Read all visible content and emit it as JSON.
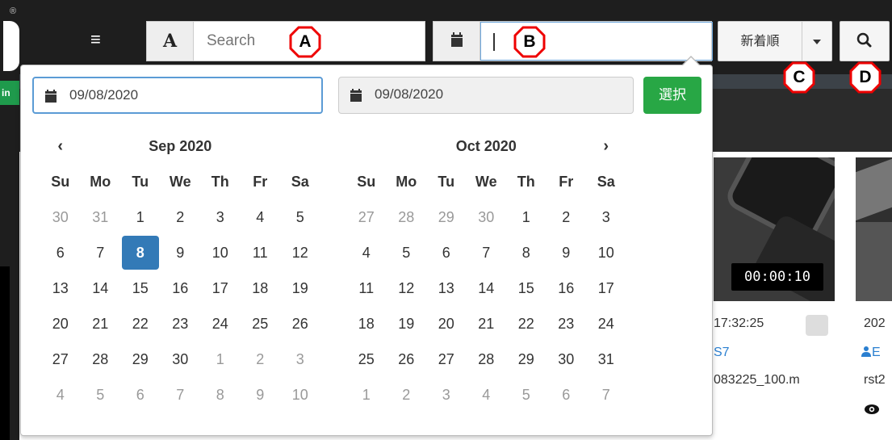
{
  "header": {
    "search_prefix": "A",
    "search_placeholder": "Search",
    "date_field_value": "",
    "sort_label": "新着順"
  },
  "annotations": {
    "a": "A",
    "b": "B",
    "c": "C",
    "d": "D"
  },
  "date_picker": {
    "start_date": "09/08/2020",
    "end_date": "09/08/2020",
    "select_label": "選択",
    "prev_label": "‹",
    "next_label": "›",
    "weekdays": [
      "Su",
      "Mo",
      "Tu",
      "We",
      "Th",
      "Fr",
      "Sa"
    ],
    "left": {
      "month": "Sep 2020",
      "weeks": [
        [
          "30",
          "31",
          "1",
          "2",
          "3",
          "4",
          "5"
        ],
        [
          "6",
          "7",
          "8",
          "9",
          "10",
          "11",
          "12"
        ],
        [
          "13",
          "14",
          "15",
          "16",
          "17",
          "18",
          "19"
        ],
        [
          "20",
          "21",
          "22",
          "23",
          "24",
          "25",
          "26"
        ],
        [
          "27",
          "28",
          "29",
          "30",
          "1",
          "2",
          "3"
        ],
        [
          "4",
          "5",
          "6",
          "7",
          "8",
          "9",
          "10"
        ]
      ],
      "selected": "8"
    },
    "right": {
      "month": "Oct 2020",
      "weeks": [
        [
          "27",
          "28",
          "29",
          "30",
          "1",
          "2",
          "3"
        ],
        [
          "4",
          "5",
          "6",
          "7",
          "8",
          "9",
          "10"
        ],
        [
          "11",
          "12",
          "13",
          "14",
          "15",
          "16",
          "17"
        ],
        [
          "18",
          "19",
          "20",
          "21",
          "22",
          "23",
          "24"
        ],
        [
          "25",
          "26",
          "27",
          "28",
          "29",
          "30",
          "31"
        ],
        [
          "1",
          "2",
          "3",
          "4",
          "5",
          "6",
          "7"
        ]
      ]
    }
  },
  "cards": [
    {
      "duration": "00:00:10",
      "time": "17:32:25",
      "user": "S7",
      "file": "083225_100.m"
    },
    {
      "time": "202",
      "user": "E",
      "file": "rst2"
    }
  ],
  "sidebar": {
    "green_tab": "in"
  },
  "colors": {
    "selected_day": "#337ab7",
    "select_button": "#28a745",
    "link": "#2a7fd0",
    "topbar": "#1e1e1e"
  }
}
